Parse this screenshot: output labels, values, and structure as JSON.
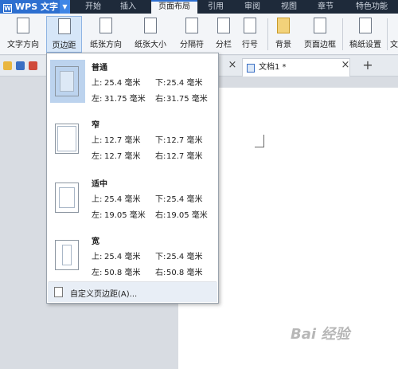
{
  "app": {
    "title": "WPS 文字"
  },
  "menu": {
    "tabs": [
      "开始",
      "插入",
      "页面布局",
      "引用",
      "审阅",
      "视图",
      "章节",
      "特色功能"
    ],
    "active": "页面布局"
  },
  "ribbon": {
    "buttons": [
      "文字方向",
      "页边距",
      "纸张方向",
      "纸张大小",
      "分隔符",
      "分栏",
      "行号",
      "背景",
      "页面边框",
      "稿纸设置",
      "文"
    ],
    "active": "页边距"
  },
  "doc_tab": {
    "title": "文档1 *"
  },
  "margin_menu": {
    "presets": [
      {
        "name": "普通",
        "top_label": "上:",
        "top": "25.4 毫米",
        "bottom_label": "下:",
        "bottom": "25.4 毫米",
        "left_label": "左:",
        "left": "31.75 毫米",
        "right_label": "右:",
        "right": "31.75 毫米",
        "selected": true
      },
      {
        "name": "窄",
        "top_label": "上:",
        "top": "12.7 毫米",
        "bottom_label": "下:",
        "bottom": "12.7 毫米",
        "left_label": "左:",
        "left": "12.7 毫米",
        "right_label": "右:",
        "right": "12.7 毫米",
        "selected": false
      },
      {
        "name": "适中",
        "top_label": "上:",
        "top": "25.4 毫米",
        "bottom_label": "下:",
        "bottom": "25.4 毫米",
        "left_label": "左:",
        "left": "19.05 毫米",
        "right_label": "右:",
        "right": "19.05 毫米",
        "selected": false
      },
      {
        "name": "宽",
        "top_label": "上:",
        "top": "25.4 毫米",
        "bottom_label": "下:",
        "bottom": "25.4 毫米",
        "left_label": "左:",
        "left": "50.8 毫米",
        "right_label": "右:",
        "right": "50.8 毫米",
        "selected": false
      }
    ],
    "custom_label": "自定义页边距(A)..."
  },
  "watermark": "Bai 经验",
  "colors": {
    "menubar": "#1e2a3a",
    "accent": "#2d6fd0",
    "ribbon": "#f3f5f8",
    "highlight": "#bcd3ee"
  }
}
